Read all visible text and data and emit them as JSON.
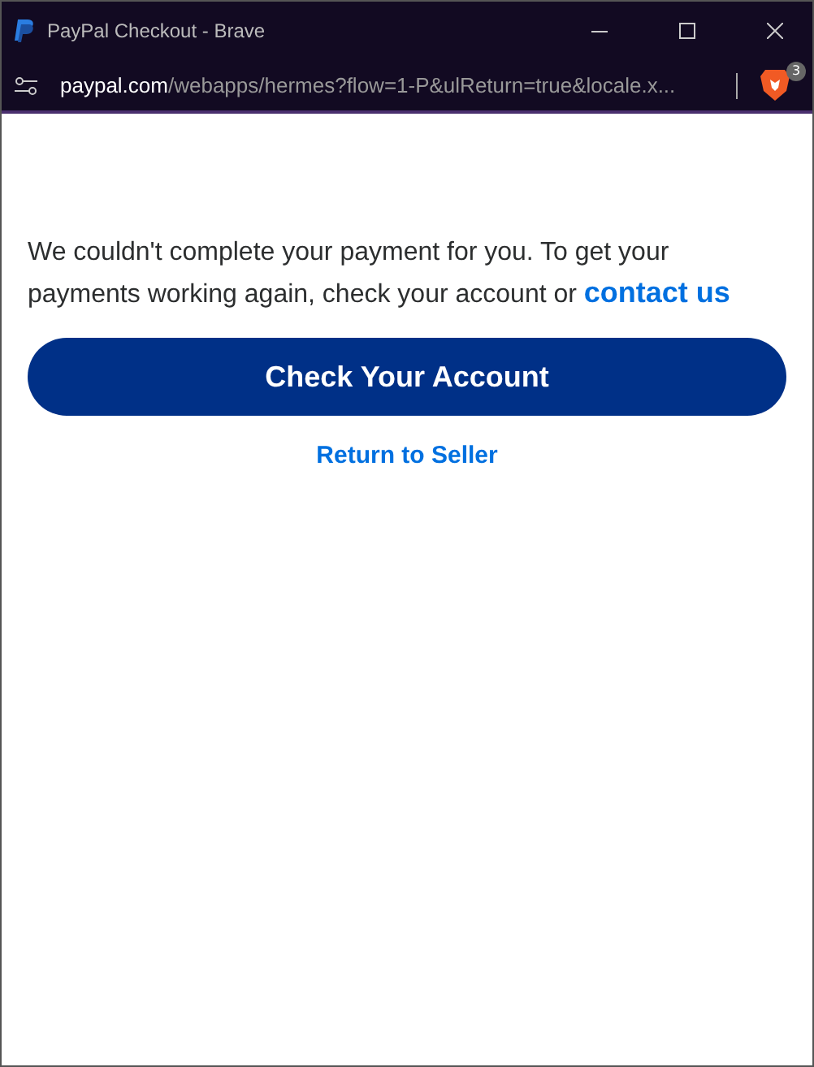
{
  "window": {
    "title": "PayPal Checkout - Brave"
  },
  "address_bar": {
    "domain": "paypal.com",
    "path": "/webapps/hermes?flow=1-P&ulReturn=true&locale.x...",
    "shields_badge": "3"
  },
  "message": {
    "text": "We couldn't complete your payment for you. To get your payments working again, check your account or ",
    "link": "contact us"
  },
  "primary_button": "Check Your Account",
  "secondary_link": "Return to Seller"
}
